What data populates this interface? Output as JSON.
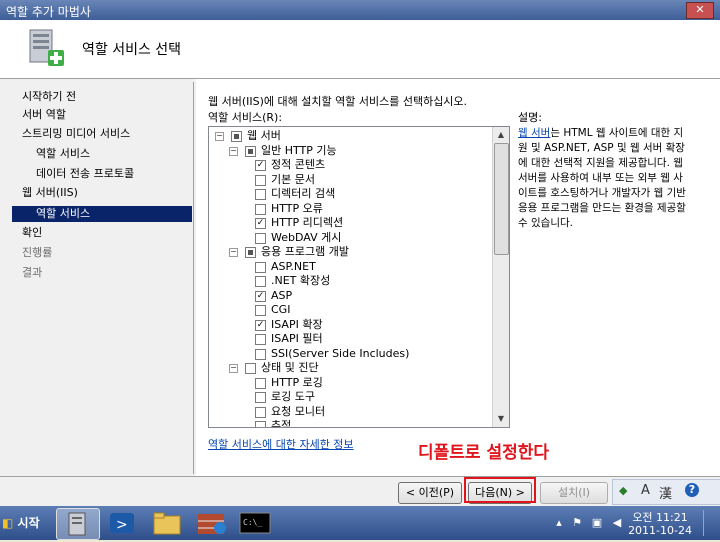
{
  "window": {
    "title": "역할 추가 마법사",
    "close": "✕"
  },
  "header": {
    "title": "역할 서비스 선택"
  },
  "nav": {
    "items": [
      {
        "label": "시작하기 전",
        "level": 0,
        "state": "normal"
      },
      {
        "label": "서버 역할",
        "level": 0,
        "state": "normal"
      },
      {
        "label": "스트리밍 미디어 서비스",
        "level": 0,
        "state": "normal"
      },
      {
        "label": "역할 서비스",
        "level": 1,
        "state": "normal"
      },
      {
        "label": "데이터 전송 프로토콜",
        "level": 1,
        "state": "normal"
      },
      {
        "label": "웹 서버(IIS)",
        "level": 0,
        "state": "normal"
      },
      {
        "label": "역할 서비스",
        "level": 1,
        "state": "selected"
      },
      {
        "label": "확인",
        "level": 0,
        "state": "normal"
      },
      {
        "label": "진행률",
        "level": 0,
        "state": "disabled"
      },
      {
        "label": "결과",
        "level": 0,
        "state": "disabled"
      }
    ]
  },
  "content": {
    "intro": "웹 서버(IIS)에 대해 설치할 역할 서비스를 선택하십시오.",
    "roles_label": "역할 서비스(R):",
    "description_label": "설명:",
    "description_link": "웹 서버",
    "description_text": "는 HTML 웹 사이트에 대한 지원 및 ASP.NET, ASP 및 웹 서버 확장에 대한 선택적 지원을 제공합니다. 웹 서버를 사용하여 내부 또는 외부 웹 사이트를 호스팅하거나 개발자가 웹 기반 응용 프로그램을 만드는 환경을 제공할 수 있습니다.",
    "more_info": "역할 서비스에 대한 자세한 정보",
    "tree": [
      {
        "label": "웹 서버",
        "level": 0,
        "expander": "⊟",
        "check": "partial"
      },
      {
        "label": "일반 HTTP 기능",
        "level": 1,
        "expander": "⊟",
        "check": "partial"
      },
      {
        "label": "정적 콘텐츠",
        "level": 2,
        "check": "checked"
      },
      {
        "label": "기본 문서",
        "level": 2,
        "check": "unchecked"
      },
      {
        "label": "디렉터리 검색",
        "level": 2,
        "check": "unchecked"
      },
      {
        "label": "HTTP 오류",
        "level": 2,
        "check": "unchecked"
      },
      {
        "label": "HTTP 리디렉션",
        "level": 2,
        "check": "checked"
      },
      {
        "label": "WebDAV 게시",
        "level": 2,
        "check": "unchecked"
      },
      {
        "label": "응용 프로그램 개발",
        "level": 1,
        "expander": "⊟",
        "check": "partial"
      },
      {
        "label": "ASP.NET",
        "level": 2,
        "check": "unchecked"
      },
      {
        "label": ".NET 확장성",
        "level": 2,
        "check": "unchecked"
      },
      {
        "label": "ASP",
        "level": 2,
        "check": "checked"
      },
      {
        "label": "CGI",
        "level": 2,
        "check": "unchecked"
      },
      {
        "label": "ISAPI 확장",
        "level": 2,
        "check": "checked"
      },
      {
        "label": "ISAPI 필터",
        "level": 2,
        "check": "unchecked"
      },
      {
        "label": "SSI(Server Side Includes)",
        "level": 2,
        "check": "unchecked"
      },
      {
        "label": "상태 및 진단",
        "level": 1,
        "expander": "⊟",
        "check": "unchecked"
      },
      {
        "label": "HTTP 로깅",
        "level": 2,
        "check": "unchecked"
      },
      {
        "label": "로깅 도구",
        "level": 2,
        "check": "unchecked"
      },
      {
        "label": "요청 모니터",
        "level": 2,
        "check": "unchecked"
      },
      {
        "label": "추적",
        "level": 2,
        "check": "unchecked"
      }
    ]
  },
  "annotation": "디폴트로 설정한다",
  "buttons": {
    "prev": "< 이전(P)",
    "next": "다음(N) >",
    "install": "설치(I)"
  },
  "langbar": {
    "a": "A",
    "han": "漢",
    "help": "?"
  },
  "taskbar": {
    "start": "시작",
    "clock_time": "오전 11:21",
    "clock_date": "2011-10-24"
  },
  "colors": {
    "accent": "#0a246a",
    "annotation": "#e0151b"
  }
}
